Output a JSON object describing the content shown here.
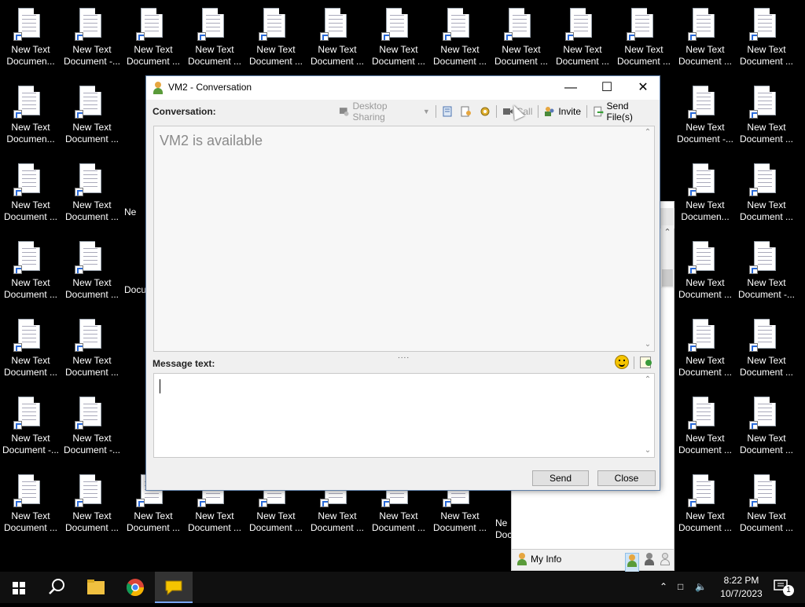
{
  "desktop": {
    "icons": [
      {
        "line1": "New Text",
        "line2": "Documen..."
      },
      {
        "line1": "New Text",
        "line2": "Document -..."
      },
      {
        "line1": "New Text",
        "line2": "Document ..."
      },
      {
        "line1": "New Text",
        "line2": "Document ..."
      },
      {
        "line1": "New Text",
        "line2": "Document ..."
      },
      {
        "line1": "New Text",
        "line2": "Document ..."
      },
      {
        "line1": "New Text",
        "line2": "Document ..."
      },
      {
        "line1": "New Text",
        "line2": "Document ..."
      },
      {
        "line1": "New Text",
        "line2": "Document ..."
      },
      {
        "line1": "New Text",
        "line2": "Document ..."
      },
      {
        "line1": "New Text",
        "line2": "Document ..."
      },
      {
        "line1": "New Text",
        "line2": "Document ..."
      },
      {
        "line1": "New Text",
        "line2": "Document ..."
      },
      {
        "line1": "New Text",
        "line2": "Documen..."
      },
      {
        "line1": "New Text",
        "line2": "Document ..."
      },
      {
        "line1": "New Text",
        "line2": "Document -..."
      },
      {
        "line1": "New Text",
        "line2": "Document ..."
      },
      {
        "line1": "New Text",
        "line2": "Document ..."
      },
      {
        "line1": "New Text",
        "line2": "Document ..."
      },
      {
        "line1": "New Text",
        "line2": "Documen..."
      },
      {
        "line1": "New Text",
        "line2": "Document ..."
      },
      {
        "line1": "New Text",
        "line2": "Document ..."
      },
      {
        "line1": "New Text",
        "line2": "Document ..."
      },
      {
        "line1": "New Text",
        "line2": "Document ..."
      },
      {
        "line1": "New Text",
        "line2": "Document -..."
      },
      {
        "line1": "New Text",
        "line2": "Document ..."
      },
      {
        "line1": "New Text",
        "line2": "Document ..."
      },
      {
        "line1": "New Text",
        "line2": "Document ..."
      },
      {
        "line1": "New Text",
        "line2": "Document ..."
      },
      {
        "line1": "New Text",
        "line2": "Document -..."
      },
      {
        "line1": "New Text",
        "line2": "Document -..."
      },
      {
        "line1": "New Text",
        "line2": "Document ..."
      },
      {
        "line1": "New Text",
        "line2": "Document ..."
      },
      {
        "line1": "New Text",
        "line2": "Document ..."
      },
      {
        "line1": "New Text",
        "line2": "Document ..."
      },
      {
        "line1": "New Text",
        "line2": "Document ..."
      },
      {
        "line1": "New Text",
        "line2": "Document ..."
      },
      {
        "line1": "New Text",
        "line2": "Document ..."
      },
      {
        "line1": "New Text",
        "line2": "Document ..."
      },
      {
        "line1": "New Text",
        "line2": "Document ..."
      },
      {
        "line1": "New Text",
        "line2": "Document ..."
      },
      {
        "line1": "New Text",
        "line2": "Document ..."
      },
      {
        "line1": "New Text",
        "line2": "Document ..."
      },
      {
        "line1": "New Text",
        "line2": "Document ..."
      },
      {
        "line1": "New Text",
        "line2": "Document ..."
      },
      {
        "line1": "New Text",
        "line2": "Document ..."
      },
      {
        "line1": "New Text",
        "line2": "Document ..."
      },
      {
        "line1": "New Text",
        "line2": "Document ..."
      },
      {
        "line1": "New Text",
        "line2": "Document ..."
      },
      {
        "line1": "New Text",
        "line2": "Document ..."
      },
      {
        "line1": "New Text",
        "line2": "Document ..."
      }
    ],
    "partial_labels": [
      "Ne",
      "Docu",
      "Ne",
      "Doc"
    ]
  },
  "contacts_window": {
    "my_info_label": "My Info",
    "status_icons": [
      "online-status-icon",
      "away-status-icon",
      "offline-status-icon"
    ]
  },
  "conversation_window": {
    "title": "VM2 - Conversation",
    "conversation_label": "Conversation:",
    "toolbar": {
      "desktop_sharing": "Desktop Sharing",
      "call": "Call",
      "invite": "Invite",
      "send_files": "Send File(s)"
    },
    "status_text": "VM2 is available",
    "message_label": "Message text:",
    "message_value": "",
    "send_button": "Send",
    "close_button": "Close"
  },
  "taskbar": {
    "time": "8:22 PM",
    "date": "10/7/2023",
    "notification_count": "1"
  },
  "colors": {
    "desktop_bg": "#000000",
    "window_bg": "#f0f0f0",
    "taskbar_bg": "#101010"
  }
}
